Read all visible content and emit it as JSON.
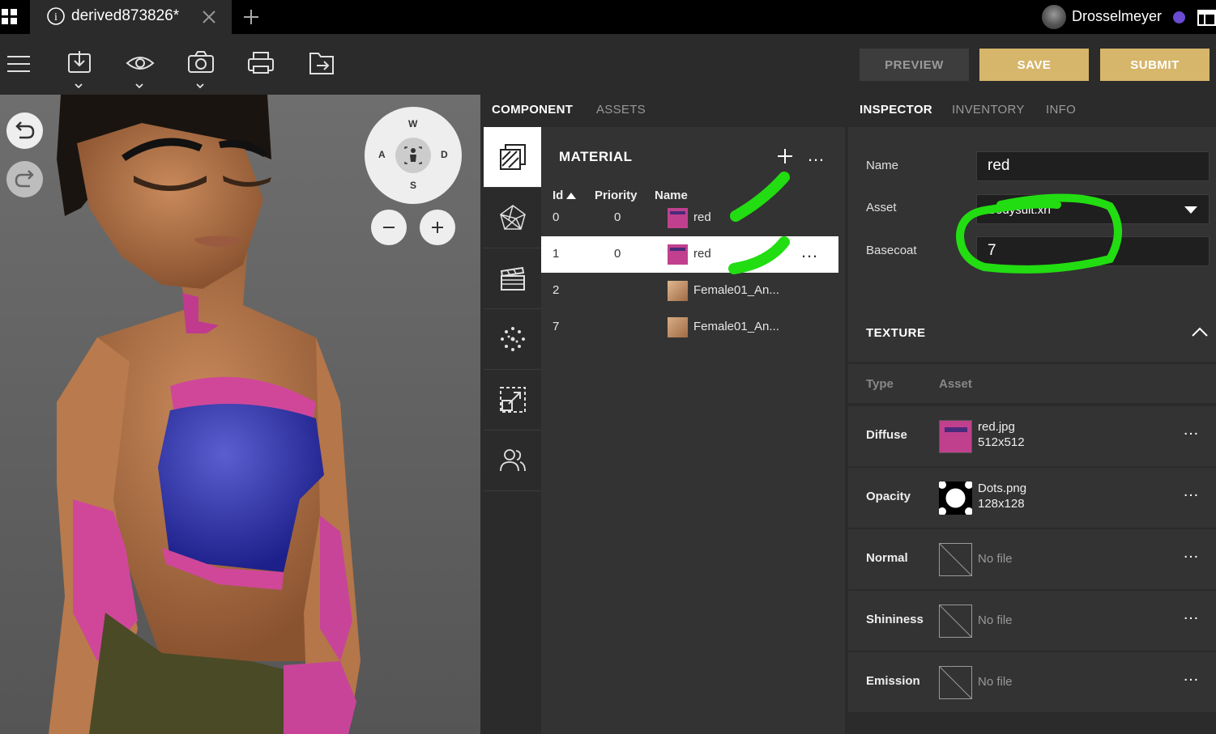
{
  "window": {
    "tab_title": "derived873826*",
    "username": "Drosselmeyer"
  },
  "header": {
    "preview_label": "PREVIEW",
    "save_label": "SAVE",
    "submit_label": "SUBMIT"
  },
  "compass": {
    "n": "W",
    "w": "A",
    "e": "D",
    "s": "S"
  },
  "component_panel": {
    "tabs": [
      "COMPONENT",
      "ASSETS"
    ],
    "section_title": "MATERIAL",
    "columns": [
      "Id",
      "Priority",
      "Name"
    ],
    "rows": [
      {
        "id": "0",
        "priority": "0",
        "name": "red",
        "thumb": "red-texture"
      },
      {
        "id": "1",
        "priority": "0",
        "name": "red",
        "thumb": "red-texture",
        "selected": true
      },
      {
        "id": "2",
        "priority": "",
        "name": "Female01_An...",
        "thumb": "skin-texture"
      },
      {
        "id": "7",
        "priority": "",
        "name": "Female01_An...",
        "thumb": "skin-texture"
      }
    ]
  },
  "inspector": {
    "tabs": [
      "INSPECTOR",
      "INVENTORY",
      "INFO"
    ],
    "name_label": "Name",
    "name_value": "red",
    "asset_label": "Asset",
    "asset_value": "Bodysuit.xrf",
    "basecoat_label": "Basecoat",
    "basecoat_value": "7",
    "texture_title": "TEXTURE",
    "texture_columns": [
      "Type",
      "Asset"
    ],
    "textures": [
      {
        "type": "Diffuse",
        "file": "red.jpg",
        "size": "512x512"
      },
      {
        "type": "Opacity",
        "file": "Dots.png",
        "size": "128x128"
      },
      {
        "type": "Normal",
        "file": "No file",
        "size": ""
      },
      {
        "type": "Shininess",
        "file": "No file",
        "size": ""
      },
      {
        "type": "Emission",
        "file": "No file",
        "size": ""
      }
    ]
  },
  "colors": {
    "accent_gold": "#d6b66b",
    "annotation_green": "#22dd11",
    "dark_bg": "#2b2b2b",
    "selected_row": "#ffffff"
  }
}
